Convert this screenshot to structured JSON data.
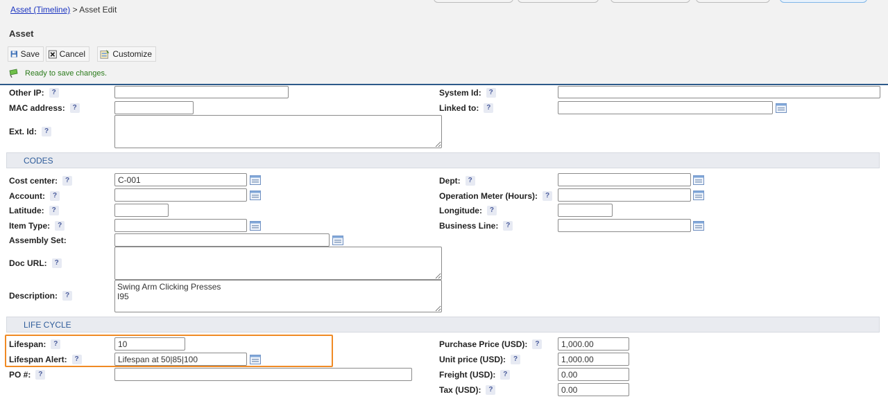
{
  "breadcrumb": {
    "link": "Asset (Timeline)",
    "separator": " > ",
    "current": "Asset Edit"
  },
  "page_title": "Asset",
  "toolbar": {
    "save": "Save",
    "cancel": "Cancel",
    "customize": "Customize"
  },
  "status_text": "Ready to save changes.",
  "help_mark": "?",
  "fields": {
    "other_ip": {
      "label": "Other IP:",
      "value": ""
    },
    "system_id": {
      "label": "System Id:",
      "value": ""
    },
    "mac_address": {
      "label": "MAC address:",
      "value": ""
    },
    "linked_to": {
      "label": "Linked to:",
      "value": ""
    },
    "ext_id": {
      "label": "Ext. Id:",
      "value": ""
    },
    "cost_center": {
      "label": "Cost center:",
      "value": "C-001"
    },
    "dept": {
      "label": "Dept:",
      "value": ""
    },
    "account": {
      "label": "Account:",
      "value": ""
    },
    "operation_meter": {
      "label": "Operation Meter (Hours):",
      "value": ""
    },
    "latitude": {
      "label": "Latitude:",
      "value": ""
    },
    "longitude": {
      "label": "Longitude:",
      "value": ""
    },
    "item_type": {
      "label": "Item Type:",
      "value": ""
    },
    "business_line": {
      "label": "Business Line:",
      "value": ""
    },
    "assembly_set": {
      "label": "Assembly Set:",
      "value": ""
    },
    "doc_url": {
      "label": "Doc URL:",
      "value": ""
    },
    "description": {
      "label": "Description:",
      "value": "Swing Arm Clicking Presses\nI95"
    },
    "lifespan": {
      "label": "Lifespan:",
      "value": "10"
    },
    "lifespan_alert": {
      "label": "Lifespan Alert:",
      "value": "Lifespan at 50|85|100"
    },
    "po_number": {
      "label": "PO #:",
      "value": ""
    },
    "purchase_price": {
      "label": "Purchase Price (USD):",
      "value": "1,000.00"
    },
    "unit_price": {
      "label": "Unit price (USD):",
      "value": "1,000.00"
    },
    "freight": {
      "label": "Freight (USD):",
      "value": "0.00"
    },
    "tax": {
      "label": "Tax (USD):",
      "value": "0.00"
    }
  },
  "sections": {
    "codes": "CODES",
    "life_cycle": "LIFE CYCLE"
  },
  "colors": {
    "link": "#1a33c0",
    "section_text": "#2e5c9a",
    "highlight": "#f08a24",
    "status": "#2a7a1a",
    "panel_rule": "#2d5a8a"
  },
  "icons": {
    "save": "floppy-disk-icon",
    "cancel": "close-box-icon",
    "customize": "customize-icon",
    "status": "flag-icon",
    "picker": "lookup-list-icon"
  }
}
